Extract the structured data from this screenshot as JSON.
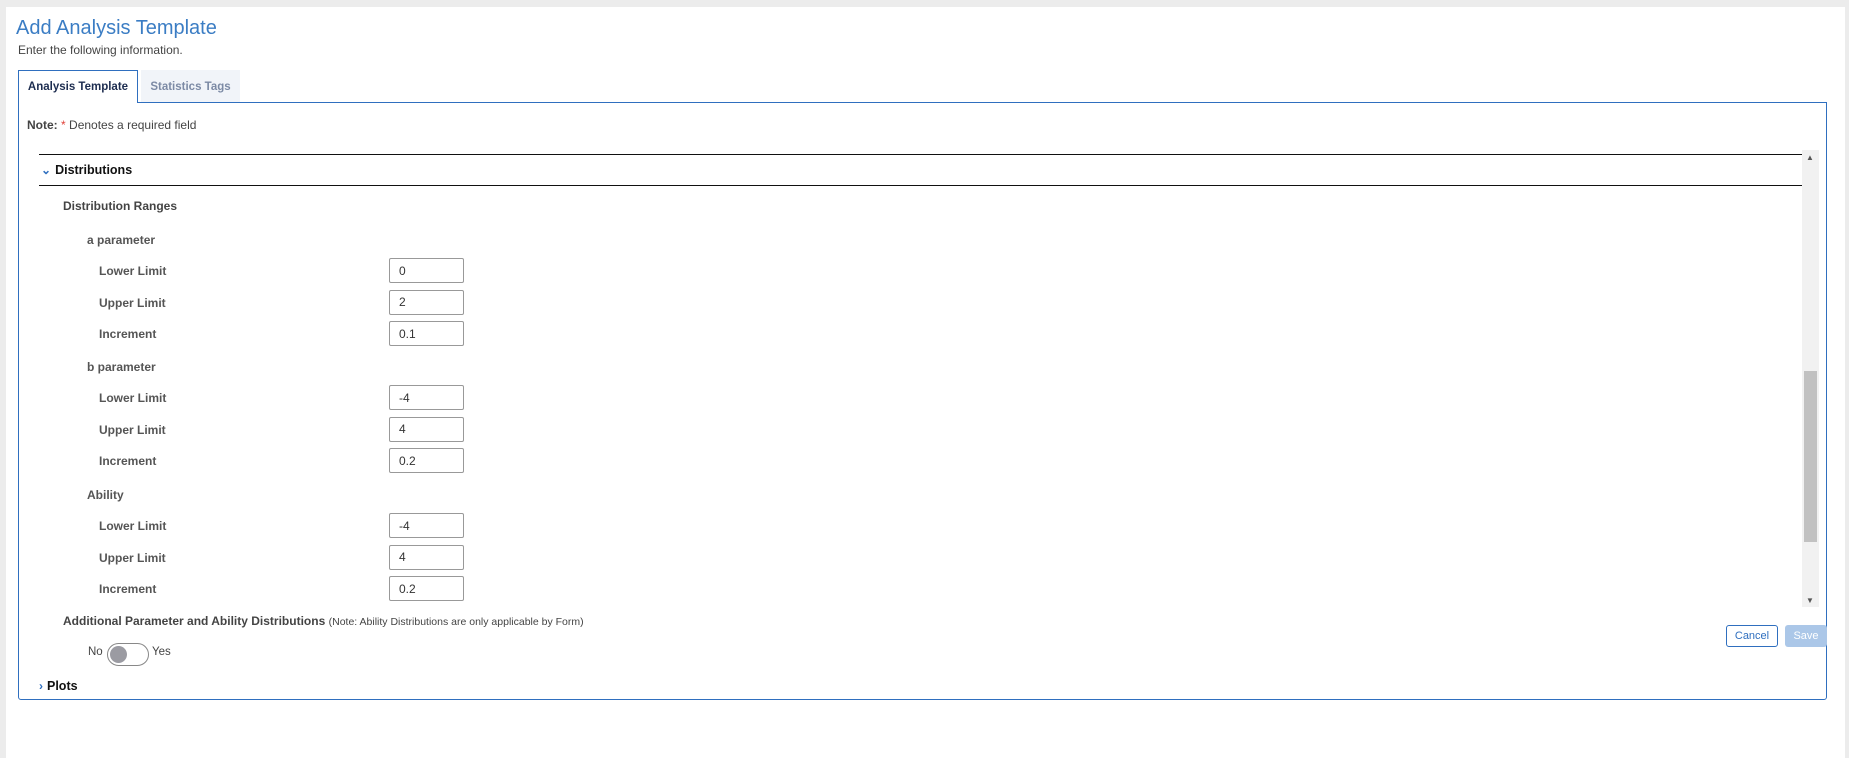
{
  "header": {
    "title": "Add Analysis Template",
    "subtitle": "Enter the following information."
  },
  "tabs": [
    {
      "label": "Analysis Template",
      "active": true
    },
    {
      "label": "Statistics Tags",
      "active": false
    }
  ],
  "note": {
    "label": "Note:",
    "star": "*",
    "text": "Denotes a required field"
  },
  "sections": {
    "distributions": {
      "label": "Distributions",
      "expanded": true
    },
    "plots": {
      "label": "Plots",
      "expanded": false
    }
  },
  "ranges": {
    "title": "Distribution Ranges",
    "groups": [
      {
        "label": "a parameter",
        "fields": [
          {
            "label": "Lower Limit",
            "value": "0"
          },
          {
            "label": "Upper Limit",
            "value": "2"
          },
          {
            "label": "Increment",
            "value": "0.1"
          }
        ]
      },
      {
        "label": "b parameter",
        "fields": [
          {
            "label": "Lower Limit",
            "value": "-4"
          },
          {
            "label": "Upper Limit",
            "value": "4"
          },
          {
            "label": "Increment",
            "value": "0.2"
          }
        ]
      },
      {
        "label": "Ability",
        "fields": [
          {
            "label": "Lower Limit",
            "value": "-4"
          },
          {
            "label": "Upper Limit",
            "value": "4"
          },
          {
            "label": "Increment",
            "value": "0.2"
          }
        ]
      }
    ]
  },
  "additional": {
    "label": "Additional Parameter and Ability Distributions",
    "note": "(Note: Ability Distributions are only applicable by Form)",
    "no": "No",
    "yes": "Yes",
    "value": false
  },
  "footer": {
    "cancel": "Cancel",
    "save": "Save"
  },
  "colors": {
    "accent": "#2f6fbf",
    "title": "#3b7dc4",
    "required": "#e0423a"
  }
}
